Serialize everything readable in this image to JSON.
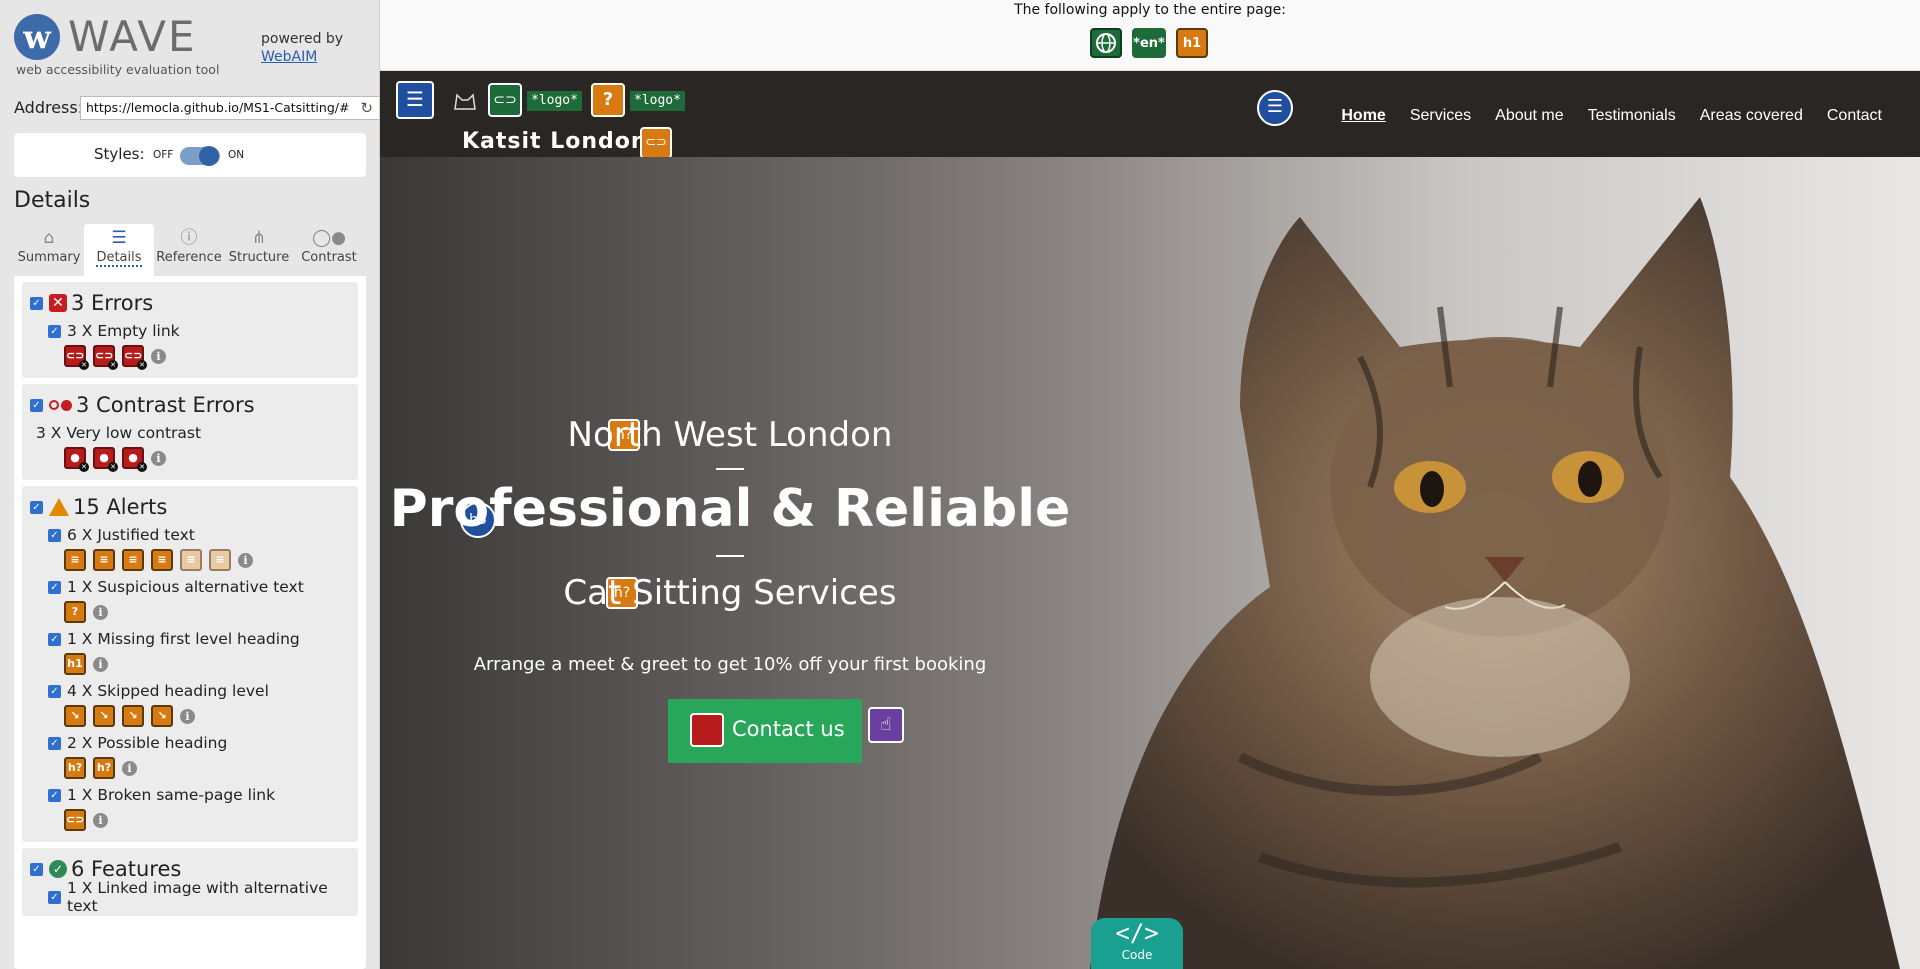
{
  "wave": {
    "logo_text": "WAVE",
    "logo_sub": "web accessibility evaluation tool",
    "powered_by": "powered by",
    "webaim": "WebAIM",
    "address_label": "Address:",
    "address_value": "https://lemocla.github.io/MS1-Catsitting/#",
    "styles_label": "Styles:",
    "styles_off": "OFF",
    "styles_on": "ON",
    "details_heading": "Details",
    "tabs": [
      {
        "label": "Summary",
        "icon": "home-icon"
      },
      {
        "label": "Details",
        "icon": "list-icon"
      },
      {
        "label": "Reference",
        "icon": "info-icon"
      },
      {
        "label": "Structure",
        "icon": "structure-icon"
      },
      {
        "label": "Contrast",
        "icon": "contrast-icon"
      }
    ],
    "active_tab": "Details",
    "sections": {
      "errors": {
        "title": "3 Errors",
        "items": [
          {
            "label": "3 X Empty link"
          }
        ]
      },
      "contrast": {
        "title": "3 Contrast Errors",
        "items": [
          {
            "label": "3 X Very low contrast"
          }
        ]
      },
      "alerts": {
        "title": "15 Alerts",
        "items": [
          {
            "label": "6 X Justified text"
          },
          {
            "label": "1 X Suspicious alternative text"
          },
          {
            "label": "1 X Missing first level heading"
          },
          {
            "label": "4 X Skipped heading level"
          },
          {
            "label": "2 X Possible heading"
          },
          {
            "label": "1 X Broken same-page link"
          }
        ]
      },
      "features": {
        "title": "6 Features",
        "items": [
          {
            "label": "1 X Linked image with alternative text"
          }
        ]
      }
    },
    "colors": {
      "error": "#c41d22",
      "alert": "#d67a11",
      "feature": "#2e8b57",
      "link": "#2a5db0"
    }
  },
  "page": {
    "top_note": "The following apply to the entire page:",
    "page_icons": [
      "language-icon",
      "*en*",
      "h1"
    ],
    "brand": "Katsit London",
    "logo_badges": [
      "*logo*",
      "*logo*"
    ],
    "nav": [
      "Home",
      "Services",
      "About me",
      "Testimonials",
      "Areas covered",
      "Contact"
    ],
    "active_nav": "Home",
    "hero_h2a": "North West London",
    "hero_h3": "Professional & Reliable",
    "hero_h2b": "Cat Sitting Services",
    "hero_sub": "Arrange a meet & greet to get 10% off your first booking",
    "contact_button": "Contact us",
    "badges": {
      "h3": "h3",
      "h2q": "h?",
      "h1": "h1"
    },
    "code_tab": "Code",
    "code_symbol": "</>"
  }
}
